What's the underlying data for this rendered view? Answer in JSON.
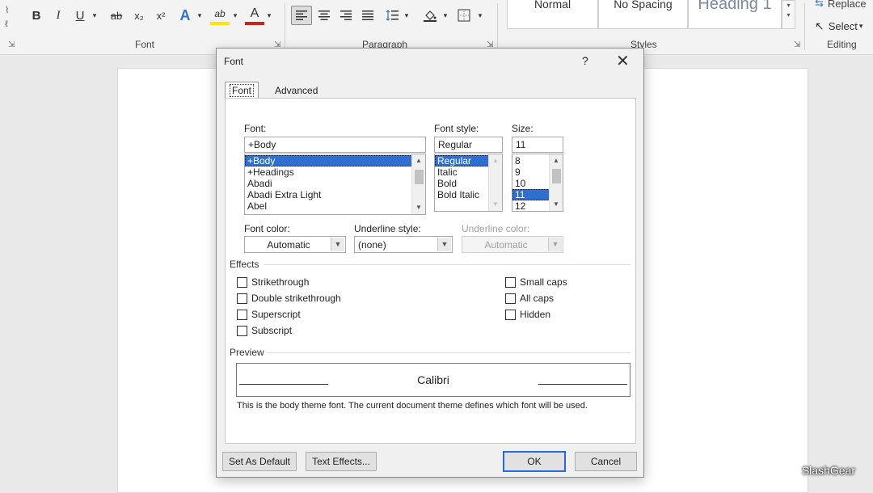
{
  "ribbon": {
    "font_group": {
      "label": "Font",
      "buttons": {
        "bold": "B",
        "italic": "I",
        "underline": "U",
        "strikethrough": "ab",
        "subscript": "x₂",
        "superscript": "x²",
        "text_effects": "A",
        "highlight": "ab",
        "font_color": "A"
      }
    },
    "paragraph_group": {
      "label": "Paragraph"
    },
    "styles_group": {
      "label": "Styles",
      "items": [
        "Normal",
        "No Spacing",
        "Heading 1"
      ]
    },
    "editing_group": {
      "label": "Editing",
      "replace": "Replace",
      "select": "Select"
    },
    "colors": {
      "highlight": "#ffe600",
      "font_color": "#d02020",
      "text_effects": "#2f73c9"
    }
  },
  "dialog": {
    "title": "Font",
    "help": "?",
    "close": "✕",
    "tabs": [
      "Font",
      "Advanced"
    ],
    "font": {
      "label": "Font:",
      "value": "+Body",
      "options": [
        "+Body",
        "+Headings",
        "Abadi",
        "Abadi Extra Light",
        "Abel"
      ],
      "selected_index": 0
    },
    "font_style": {
      "label": "Font style:",
      "value": "Regular",
      "options": [
        "Regular",
        "Italic",
        "Bold",
        "Bold Italic"
      ],
      "selected_index": 0
    },
    "size": {
      "label": "Size:",
      "value": "11",
      "options": [
        "8",
        "9",
        "10",
        "11",
        "12"
      ],
      "selected_index": 3
    },
    "font_color": {
      "label": "Font color:",
      "value": "Automatic"
    },
    "underline_style": {
      "label": "Underline style:",
      "value": "(none)"
    },
    "underline_color": {
      "label": "Underline color:",
      "value": "Automatic"
    },
    "effects": {
      "label": "Effects",
      "left": [
        "Strikethrough",
        "Double strikethrough",
        "Superscript",
        "Subscript"
      ],
      "right": [
        "Small caps",
        "All caps",
        "Hidden"
      ]
    },
    "preview": {
      "label": "Preview",
      "text": "Calibri",
      "note": "This is the body theme font. The current document theme defines which font will be used."
    },
    "buttons": {
      "set_default": "Set As Default",
      "text_effects": "Text Effects...",
      "ok": "OK",
      "cancel": "Cancel"
    },
    "accent": "#2f6fd0"
  },
  "watermark": "SlashGear"
}
